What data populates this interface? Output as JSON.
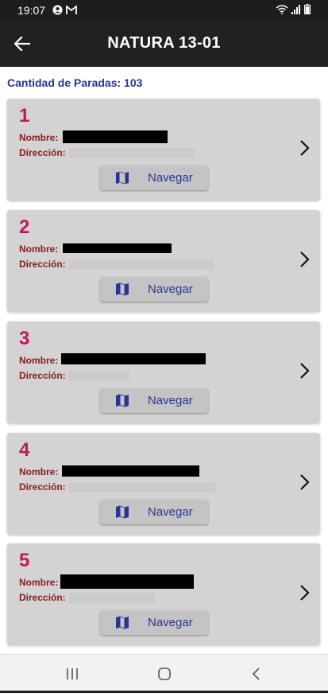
{
  "status_bar": {
    "time": "19:07",
    "left_icons": [
      "account-circle-icon",
      "gmail-icon"
    ],
    "right_icons": [
      "wifi-icon",
      "signal-icon",
      "battery-icon"
    ]
  },
  "app_bar": {
    "title": "NATURA 13-01",
    "back_icon": "arrow-back-icon"
  },
  "stops_count": "Cantidad de Paradas: 103",
  "cards": [
    {
      "number": "1",
      "name_label": "Nombre:",
      "address_label": "Dirección:",
      "nav_label": "Navegar"
    },
    {
      "number": "2",
      "name_label": "Nombre:",
      "address_label": "Dirección:",
      "nav_label": "Navegar"
    },
    {
      "number": "3",
      "name_label": "Nombre:",
      "address_label": "Dirección:",
      "nav_label": "Navegar"
    },
    {
      "number": "4",
      "name_label": "Nombre:",
      "address_label": "Dirección:",
      "nav_label": "Navegar"
    },
    {
      "number": "5",
      "name_label": "Nombre:",
      "address_label": "Dirección:",
      "nav_label": "Navegar"
    }
  ],
  "system_nav": [
    "recents-icon",
    "home-icon",
    "back-icon"
  ],
  "colors": {
    "accent_number": "#c2185b",
    "label": "#8b1a1a",
    "primary_text": "#283593",
    "card_bg": "#d3d3d3",
    "app_bar_bg": "#212121"
  }
}
